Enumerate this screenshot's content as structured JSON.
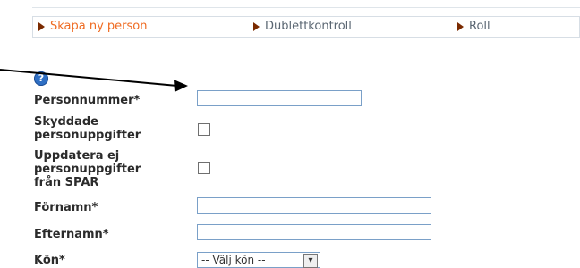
{
  "colors": {
    "active_step": "#ef6b22",
    "inactive_step": "#5a6672",
    "arrow": "#000000",
    "input_border": "#7aa0c8"
  },
  "steps": [
    {
      "label": "Skapa ny person",
      "active": true
    },
    {
      "label": "Dublettkontroll",
      "active": false
    },
    {
      "label": "Roll",
      "active": false
    }
  ],
  "help": {
    "icon": "help-icon"
  },
  "form": {
    "personnummer": {
      "label": "Personnummer*",
      "value": ""
    },
    "skyddade": {
      "label_line1": "Skyddade",
      "label_line2": "personuppgifter",
      "checked": false
    },
    "uppdatera": {
      "label_line1": "Uppdatera ej",
      "label_line2": "personuppgifter",
      "label_line3": "från SPAR",
      "checked": false
    },
    "fornamn": {
      "label": "Förnamn*",
      "value": ""
    },
    "efternamn": {
      "label": "Efternamn*",
      "value": ""
    },
    "kon": {
      "label": "Kön*",
      "selected": "-- Välj kön --"
    }
  }
}
